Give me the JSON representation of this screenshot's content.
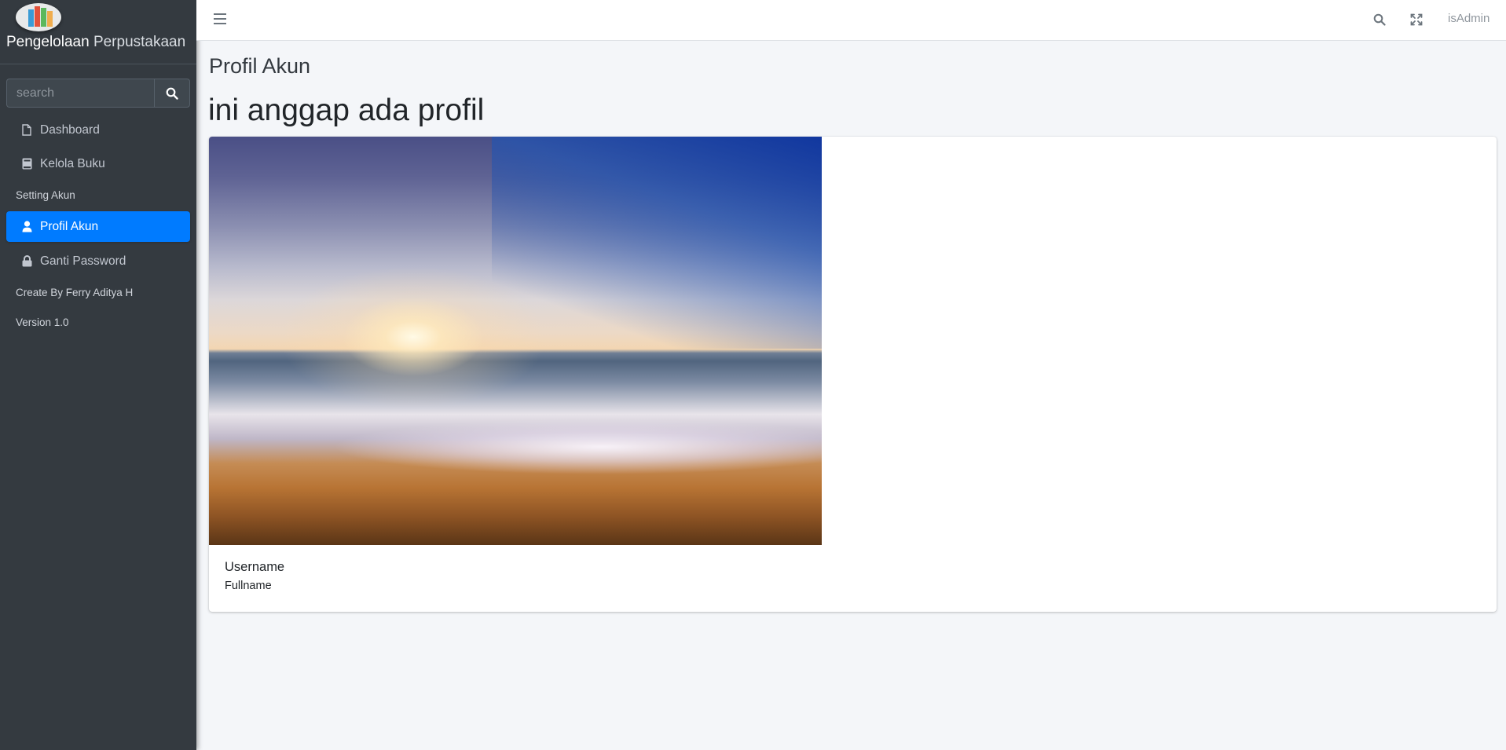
{
  "brand": {
    "name_bold": "Pengelolaan",
    "name_light": "Perpustakaan",
    "logo_icon": "library-books-logo"
  },
  "sidebar": {
    "search_placeholder": "search",
    "items": [
      {
        "label": "Dashboard",
        "icon": "file-icon",
        "active": false
      },
      {
        "label": "Kelola Buku",
        "icon": "book-icon",
        "active": false
      },
      {
        "label": "Profil Akun",
        "icon": "user-icon",
        "active": true
      },
      {
        "label": "Ganti Password",
        "icon": "lock-icon",
        "active": false
      }
    ],
    "headers": [
      "Setting Akun",
      "Create By Ferry Aditya H",
      "Version 1.0"
    ],
    "active_color": "#007bff"
  },
  "topbar": {
    "user": "isAdmin"
  },
  "content": {
    "page_title": "Profil Akun",
    "heading": "ini anggap ada profil",
    "card": {
      "username": "Username",
      "fullname": "Fullname"
    }
  }
}
